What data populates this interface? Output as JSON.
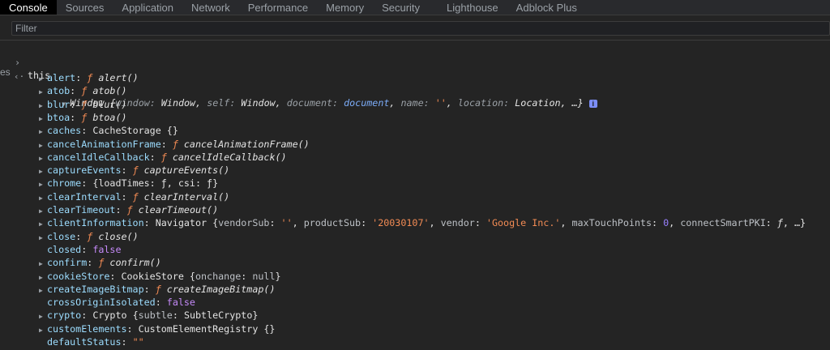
{
  "tabs": [
    "Console",
    "Sources",
    "Application",
    "Network",
    "Performance",
    "Memory",
    "Security",
    "Lighthouse",
    "Adblock Plus"
  ],
  "filter": {
    "placeholder": "Filter"
  },
  "left_fragment": "es",
  "input_command": "this",
  "window_summary": {
    "label": "Window",
    "open": "{",
    "window_key": "window",
    "window_val": "Window",
    "self_key": "self",
    "self_val": "Window",
    "document_key": "document",
    "document_val": "document",
    "name_key": "name",
    "name_val": "''",
    "location_key": "location",
    "location_val": "Location",
    "tail": "…}",
    "info": "i"
  },
  "props": [
    {
      "key": "alert",
      "type": "fn",
      "value": "alert()"
    },
    {
      "key": "atob",
      "type": "fn",
      "value": "atob()"
    },
    {
      "key": "blur",
      "type": "fn",
      "value": "blur()"
    },
    {
      "key": "btoa",
      "type": "fn",
      "value": "btoa()"
    },
    {
      "key": "caches",
      "type": "obj",
      "value": "CacheStorage {}"
    },
    {
      "key": "cancelAnimationFrame",
      "type": "fn",
      "value": "cancelAnimationFrame()"
    },
    {
      "key": "cancelIdleCallback",
      "type": "fn",
      "value": "cancelIdleCallback()"
    },
    {
      "key": "captureEvents",
      "type": "fn",
      "value": "captureEvents()"
    },
    {
      "key": "chrome",
      "type": "obj",
      "value": "{loadTimes: ƒ, csi: ƒ}"
    },
    {
      "key": "clearInterval",
      "type": "fn",
      "value": "clearInterval()"
    },
    {
      "key": "clearTimeout",
      "type": "fn",
      "value": "clearTimeout()"
    },
    {
      "key": "clientInformation",
      "type": "navigator",
      "value": ""
    },
    {
      "key": "close",
      "type": "fn",
      "value": "close()"
    },
    {
      "key": "closed",
      "type": "bool",
      "value": "false"
    },
    {
      "key": "confirm",
      "type": "fn",
      "value": "confirm()"
    },
    {
      "key": "cookieStore",
      "type": "cookie",
      "value": ""
    },
    {
      "key": "createImageBitmap",
      "type": "fn",
      "value": "createImageBitmap()"
    },
    {
      "key": "crossOriginIsolated",
      "type": "bool",
      "value": "false"
    },
    {
      "key": "crypto",
      "type": "crypto",
      "value": ""
    },
    {
      "key": "customElements",
      "type": "obj",
      "value": "CustomElementRegistry {}"
    },
    {
      "key": "defaultStatus",
      "type": "str",
      "value": "\"\""
    }
  ],
  "navigator": {
    "cls": "Navigator",
    "vendorSub_key": "vendorSub",
    "vendorSub_val": "''",
    "productSub_key": "productSub",
    "productSub_val": "'20030107'",
    "vendor_key": "vendor",
    "vendor_val": "'Google Inc.'",
    "mtp_key": "maxTouchPoints",
    "mtp_val": "0",
    "csp_key": "connectSmartPKI",
    "csp_val": "ƒ",
    "tail": "…}"
  },
  "cookie": {
    "cls": "CookieStore",
    "key": "onchange",
    "val": "null"
  },
  "crypto": {
    "cls": "Crypto",
    "key": "subtle",
    "val": "SubtleCrypto"
  }
}
